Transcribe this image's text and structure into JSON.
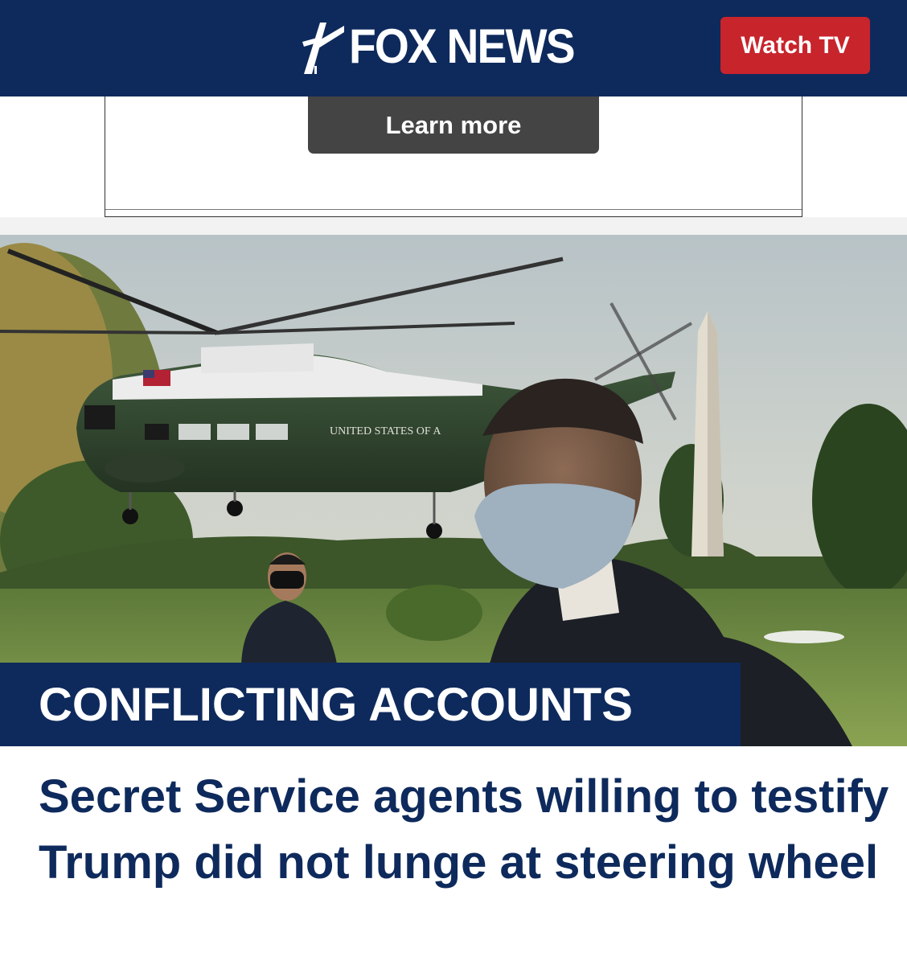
{
  "header": {
    "logo_text": "FOX NEWS",
    "watch_tv_label": "Watch TV",
    "colors": {
      "navy": "#0e2a5c",
      "red": "#c8242c"
    }
  },
  "ad": {
    "learn_more_label": "Learn more"
  },
  "article": {
    "hero_image": {
      "description_icons": [
        "helicopter",
        "washington-monument",
        "agent",
        "trees"
      ],
      "helicopter_text": "UNITED STATES OF A"
    },
    "kicker": "CONFLICTING ACCOUNTS",
    "headline": "Secret Service agents willing to testify Trump did not lunge at steering wheel"
  }
}
